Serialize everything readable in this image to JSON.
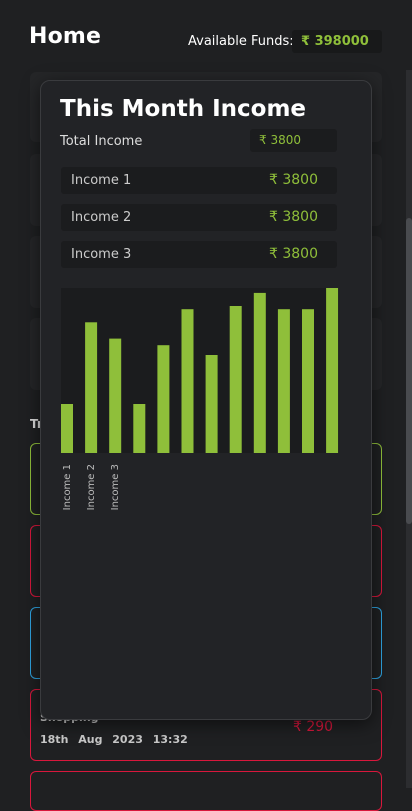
{
  "header": {
    "title": "Home",
    "funds_label": "Available Funds:",
    "funds_value": "₹ 398000"
  },
  "background": {
    "section_label": "Tr",
    "partial_transaction": {
      "name": "Shopping",
      "date": "18th Aug 2023",
      "time": "13:32",
      "amount": "₹ 290"
    }
  },
  "modal": {
    "title": "This Month Income",
    "total_label": "Total Income",
    "total_value": "₹ 3800",
    "items": [
      {
        "name": "Income 1",
        "amount": "₹ 3800"
      },
      {
        "name": "Income 2",
        "amount": "₹ 3800"
      },
      {
        "name": "Income 3",
        "amount": "₹ 3800"
      }
    ]
  },
  "colors": {
    "accent_green": "#8fbf3a",
    "expense_red": "#d8173c",
    "info_blue": "#2ea3e0"
  },
  "chart_data": {
    "type": "bar",
    "categories": [
      "Income 1",
      "Income 2",
      "Income 3",
      "",
      "",
      "",
      "",
      "",
      "",
      "",
      "",
      ""
    ],
    "values": [
      30,
      80,
      70,
      30,
      66,
      88,
      60,
      90,
      98,
      88,
      88,
      101
    ],
    "ylim": [
      0,
      101
    ],
    "grid": false,
    "bar_color": "#8fbf3a"
  }
}
